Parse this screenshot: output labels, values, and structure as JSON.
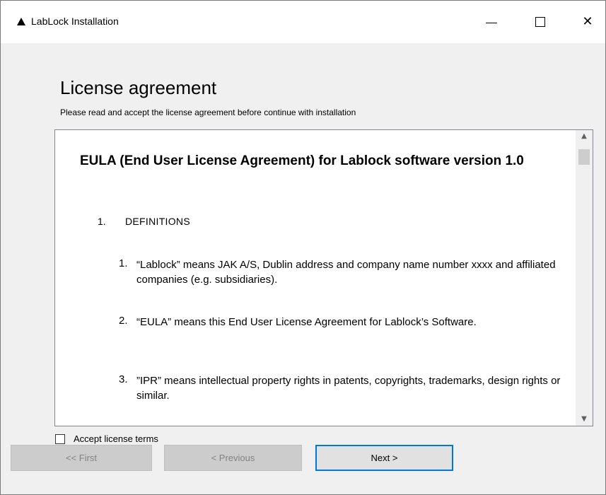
{
  "window": {
    "title": "LabLock Installation",
    "icon": "triangle-app-icon"
  },
  "page": {
    "title": "License agreement",
    "subtitle": "Please read and accept the license agreement before continue with installation"
  },
  "eula": {
    "heading": "EULA (End User License Agreement) for Lablock software version 1.0",
    "section": {
      "number": "1.",
      "title": "DEFINITIONS"
    },
    "items": [
      {
        "number": "1.",
        "text": "“Lablock” means JAK A/S, Dublin address and company name number xxxx and affiliated companies (e.g. subsidiaries)."
      },
      {
        "number": "2.",
        "text": "“EULA” means this End User License Agreement for Lablock’s Software."
      },
      {
        "number": "3.",
        "text": "”IPR” means intellectual property rights in patents, copyrights, trademarks, design rights or similar."
      }
    ]
  },
  "accept": {
    "label": "Accept license terms",
    "checked": false
  },
  "buttons": {
    "first": "<< First",
    "previous": "< Previous",
    "next": "Next >"
  },
  "colors": {
    "focus_border": "#0078d7",
    "disabled_button": "#cccccc",
    "dialog_background": "#f0f0f0"
  }
}
